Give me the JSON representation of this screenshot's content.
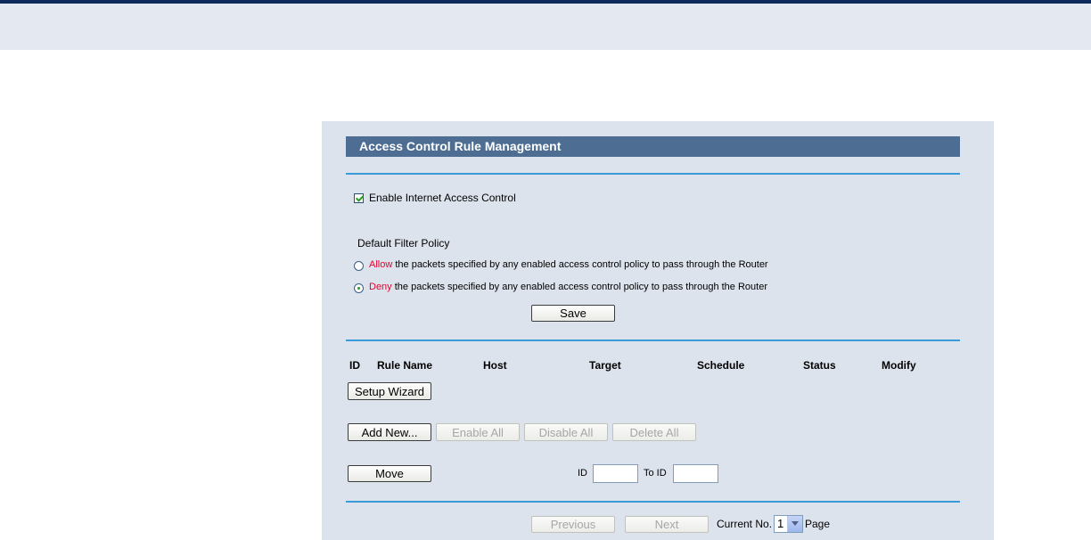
{
  "header": {},
  "panel": {
    "title": "Access Control Rule Management",
    "enable_control": {
      "label": "Enable Internet Access Control",
      "checked": true
    },
    "policy": {
      "heading": "Default Filter Policy",
      "options": [
        {
          "keyword": "Allow",
          "text": " the packets specified by any enabled access control policy to pass through the Router",
          "selected": false
        },
        {
          "keyword": "Deny",
          "text": " the packets specified by any enabled access control policy to pass through the Router",
          "selected": true
        }
      ],
      "save_label": "Save"
    },
    "table": {
      "columns": [
        "ID",
        "Rule Name",
        "Host",
        "Target",
        "Schedule",
        "Status",
        "Modify"
      ]
    },
    "buttons": {
      "setup_wizard": "Setup Wizard",
      "add_new": "Add New...",
      "enable_all": "Enable All",
      "disable_all": "Disable All",
      "delete_all": "Delete All",
      "move": "Move"
    },
    "move": {
      "id_label": "ID",
      "to_id_label": "To ID",
      "id_value": "",
      "to_id_value": ""
    },
    "pagination": {
      "previous": "Previous",
      "next": "Next",
      "current_label": "Current No.",
      "current_value": "1",
      "page_label": "Page"
    }
  },
  "colors": {
    "title_bar": "#4e6d93",
    "divider": "#3b9bd8",
    "panel_bg": "#dde3ec",
    "keyword_red": "#e8002e"
  }
}
